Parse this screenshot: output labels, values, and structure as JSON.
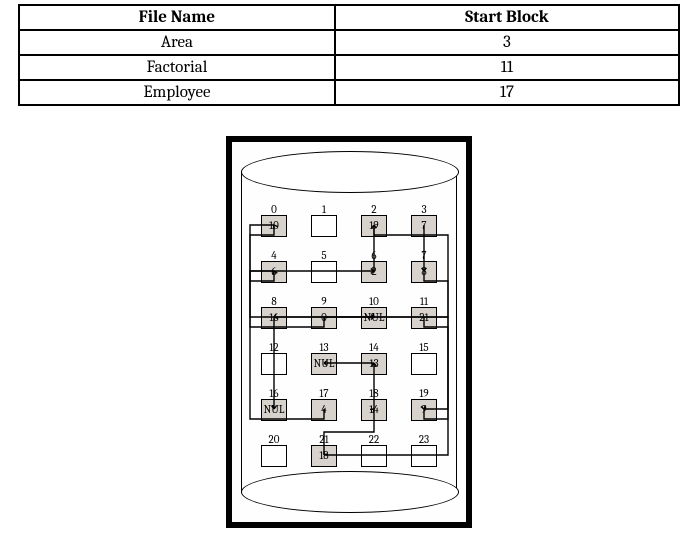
{
  "table": {
    "headers": [
      "File Name",
      "Start Block"
    ],
    "rows": [
      {
        "file": "Area",
        "start": "3"
      },
      {
        "file": "Factorial",
        "start": "11"
      },
      {
        "file": "Employee",
        "start": "17"
      }
    ]
  },
  "blocks": [
    {
      "idx": "0",
      "val": "10",
      "shaded": true
    },
    {
      "idx": "1",
      "val": "",
      "shaded": false
    },
    {
      "idx": "2",
      "val": "19",
      "shaded": true
    },
    {
      "idx": "3",
      "val": "7",
      "shaded": true
    },
    {
      "idx": "4",
      "val": "6",
      "shaded": true
    },
    {
      "idx": "5",
      "val": "",
      "shaded": false
    },
    {
      "idx": "6",
      "val": "2",
      "shaded": true
    },
    {
      "idx": "7",
      "val": "8",
      "shaded": true
    },
    {
      "idx": "8",
      "val": "16",
      "shaded": true
    },
    {
      "idx": "9",
      "val": "0",
      "shaded": true
    },
    {
      "idx": "10",
      "val": "NUL",
      "shaded": true
    },
    {
      "idx": "11",
      "val": "21",
      "shaded": true
    },
    {
      "idx": "12",
      "val": "",
      "shaded": false
    },
    {
      "idx": "13",
      "val": "NUL",
      "shaded": true
    },
    {
      "idx": "14",
      "val": "13",
      "shaded": true
    },
    {
      "idx": "15",
      "val": "",
      "shaded": false
    },
    {
      "idx": "16",
      "val": "NUL",
      "shaded": true
    },
    {
      "idx": "17",
      "val": "4",
      "shaded": true
    },
    {
      "idx": "18",
      "val": "14",
      "shaded": true
    },
    {
      "idx": "19",
      "val": "9",
      "shaded": true
    },
    {
      "idx": "20",
      "val": "",
      "shaded": false
    },
    {
      "idx": "21",
      "val": "18",
      "shaded": true
    },
    {
      "idx": "22",
      "val": "",
      "shaded": false
    },
    {
      "idx": "23",
      "val": "",
      "shaded": false
    }
  ],
  "links": [
    {
      "from": 3,
      "to": 7
    },
    {
      "from": 7,
      "to": 8
    },
    {
      "from": 8,
      "to": 16
    },
    {
      "from": 0,
      "to": 10
    },
    {
      "from": 10,
      "to": 10
    },
    {
      "from": 11,
      "to": 21
    },
    {
      "from": 21,
      "to": 18
    },
    {
      "from": 18,
      "to": 14
    },
    {
      "from": 14,
      "to": 13
    },
    {
      "from": 17,
      "to": 4
    },
    {
      "from": 4,
      "to": 6
    },
    {
      "from": 6,
      "to": 2
    },
    {
      "from": 2,
      "to": 19
    },
    {
      "from": 19,
      "to": 9
    },
    {
      "from": 9,
      "to": 0
    }
  ]
}
